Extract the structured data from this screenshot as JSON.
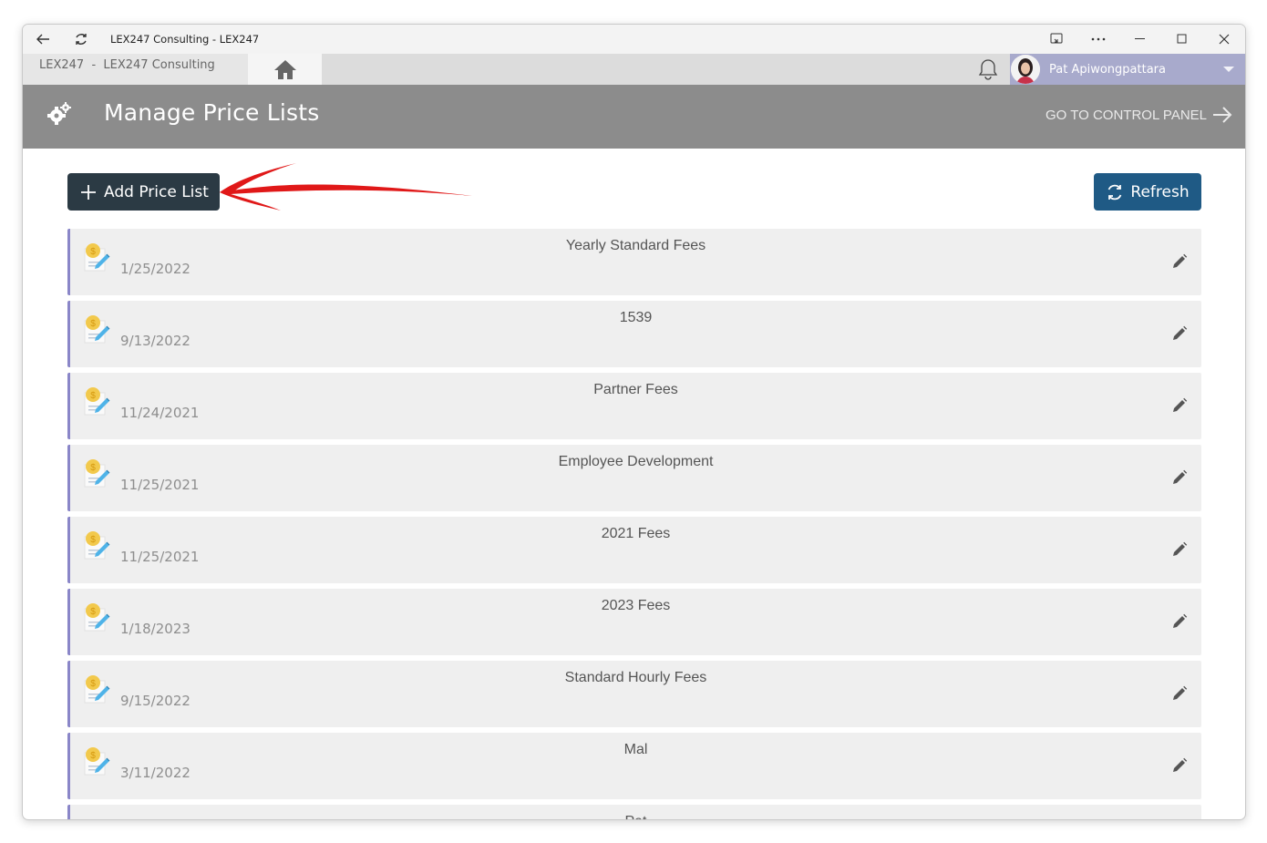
{
  "window": {
    "title": "LEX247 Consulting - LEX247"
  },
  "appbar": {
    "breadcrumb": "LEX247  -  LEX247 Consulting",
    "user_name": "Pat Apiwongpattara"
  },
  "header": {
    "title": "Manage Price Lists",
    "control_panel_label": "GO TO CONTROL PANEL"
  },
  "toolbar": {
    "add_label": "Add Price List",
    "refresh_label": "Refresh"
  },
  "price_lists": [
    {
      "name": "Yearly Standard Fees",
      "date": "1/25/2022"
    },
    {
      "name": "1539",
      "date": "9/13/2022"
    },
    {
      "name": "Partner Fees",
      "date": "11/24/2021"
    },
    {
      "name": "Employee Development",
      "date": "11/25/2021"
    },
    {
      "name": "2021 Fees",
      "date": "11/25/2021"
    },
    {
      "name": "2023 Fees",
      "date": "1/18/2023"
    },
    {
      "name": "Standard Hourly Fees",
      "date": "9/15/2022"
    },
    {
      "name": "Mal",
      "date": "3/11/2022"
    },
    {
      "name": "Pat",
      "date": ""
    }
  ],
  "colors": {
    "header_bg": "#8c8c8c",
    "add_button": "#2b3a44",
    "refresh_button": "#1f5a85",
    "item_accent": "#8a86c8",
    "user_box": "#a8aacc",
    "annotation_arrow": "#e01818"
  },
  "icons": {
    "back": "back-arrow-icon",
    "reload": "reload-icon",
    "home": "home-icon",
    "bell": "bell-icon",
    "settings": "gears-icon",
    "edit": "pencil-icon",
    "price_list": "price-list-document-icon"
  }
}
